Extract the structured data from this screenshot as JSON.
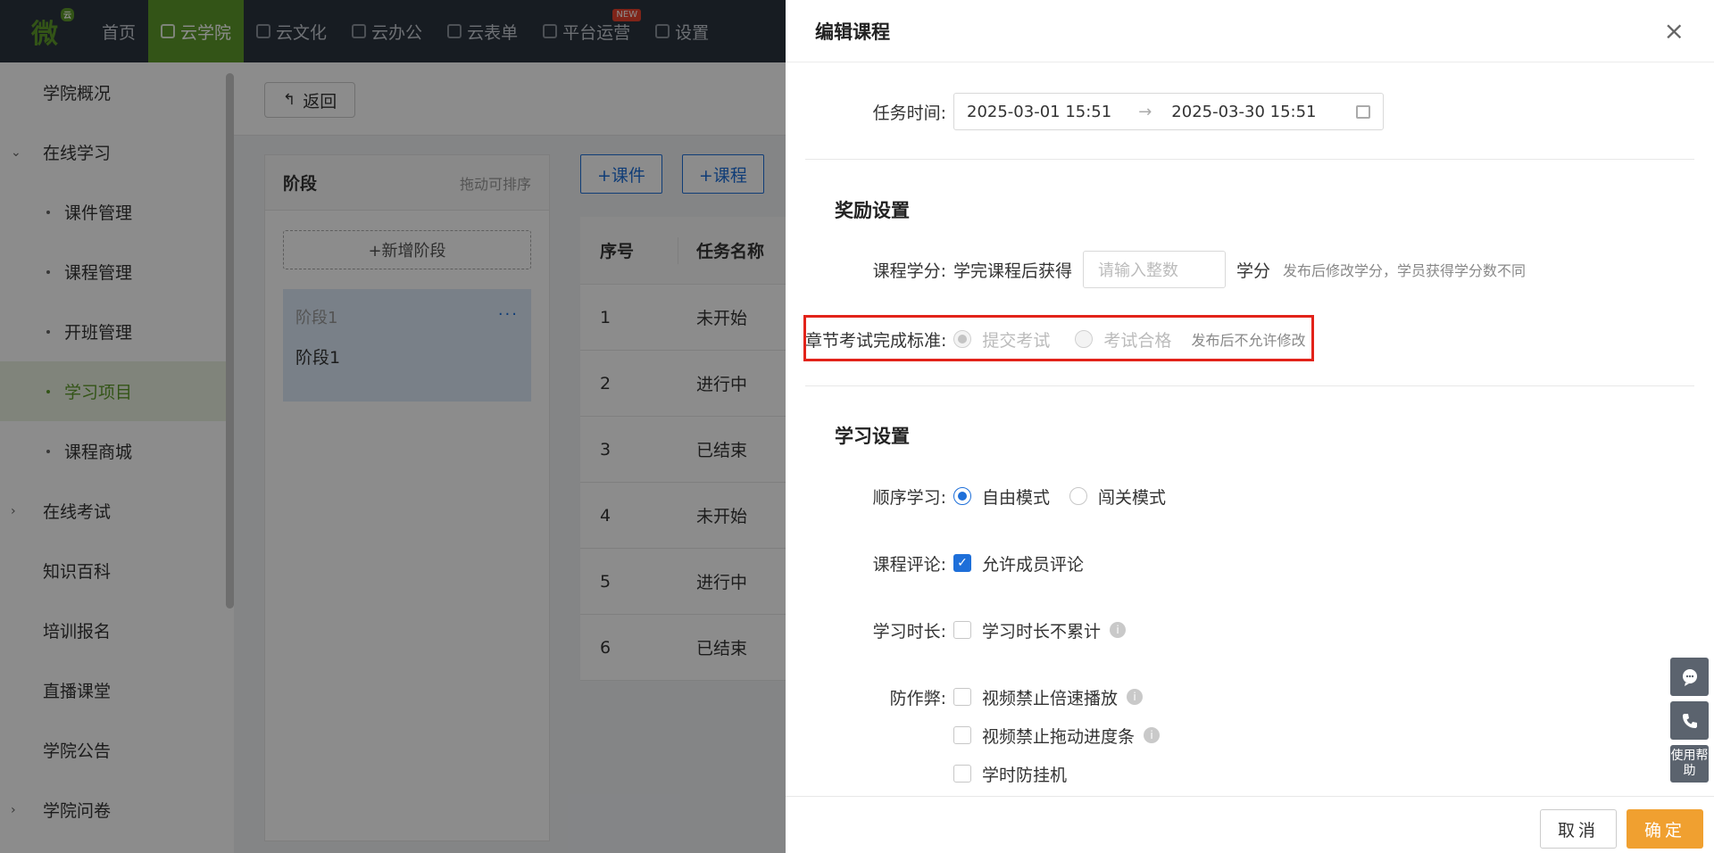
{
  "nav": {
    "logo_text": "微",
    "logo_sup": "云",
    "items": [
      {
        "label": "首页"
      },
      {
        "label": "云学院"
      },
      {
        "label": "云文化"
      },
      {
        "label": "云办公"
      },
      {
        "label": "云表单"
      },
      {
        "label": "平台运营",
        "badge": "NEW"
      },
      {
        "label": "设置"
      }
    ],
    "active_index": 1
  },
  "sidebar": {
    "items": [
      {
        "label": "学院概况"
      },
      {
        "label": "在线学习",
        "caret": "⌄"
      },
      {
        "label": "课件管理"
      },
      {
        "label": "课程管理"
      },
      {
        "label": "开班管理"
      },
      {
        "label": "学习项目"
      },
      {
        "label": "课程商城"
      },
      {
        "label": "在线考试",
        "caret": "›"
      },
      {
        "label": "知识百科"
      },
      {
        "label": "培训报名"
      },
      {
        "label": "直播课堂"
      },
      {
        "label": "学院公告"
      },
      {
        "label": "学院问卷",
        "caret": "›"
      }
    ]
  },
  "main": {
    "back_label": "返回",
    "stage_title": "阶段",
    "stage_hint": "拖动可排序",
    "add_stage": "+新增阶段",
    "stage_card": {
      "name_top": "阶段1",
      "more": "···",
      "name": "阶段1"
    },
    "task_buttons": [
      "+课件",
      "+课程"
    ],
    "table": {
      "headers": [
        "序号",
        "任务名称"
      ],
      "rows": [
        [
          "1",
          "未开始"
        ],
        [
          "2",
          "进行中"
        ],
        [
          "3",
          "已结束"
        ],
        [
          "4",
          "未开始"
        ],
        [
          "5",
          "进行中"
        ],
        [
          "6",
          "已结束"
        ]
      ]
    }
  },
  "drawer": {
    "title": "编辑课程",
    "close": "×",
    "task_time": {
      "label": "任务时间:",
      "start": "2025-03-01 15:51",
      "sep": "→",
      "end": "2025-03-30 15:51"
    },
    "reward": {
      "title": "奖励设置",
      "credit_label": "课程学分:",
      "credit_prefix": "学完课程后获得",
      "credit_placeholder": "请输入整数",
      "credit_unit": "学分",
      "credit_hint": "发布后修改学分，学员获得学分数不同"
    },
    "exam_standard": {
      "label": "章节考试完成标准:",
      "option1": "提交考试",
      "option2": "考试合格",
      "hint": "发布后不允许修改"
    },
    "study": {
      "title": "学习设置",
      "order_label": "顺序学习:",
      "order_opt1": "自由模式",
      "order_opt2": "闯关模式",
      "comment_label": "课程评论:",
      "comment_opt": "允许成员评论",
      "duration_label": "学习时长:",
      "duration_opt": "学习时长不累计",
      "anticheat_label": "防作弊:",
      "anticheat_opt1": "视频禁止倍速播放",
      "anticheat_opt2": "视频禁止拖动进度条",
      "anticheat_opt3": "学时防挂机"
    },
    "cancel": "取消",
    "ok": "确定"
  },
  "help": {
    "label": "使用帮助"
  }
}
